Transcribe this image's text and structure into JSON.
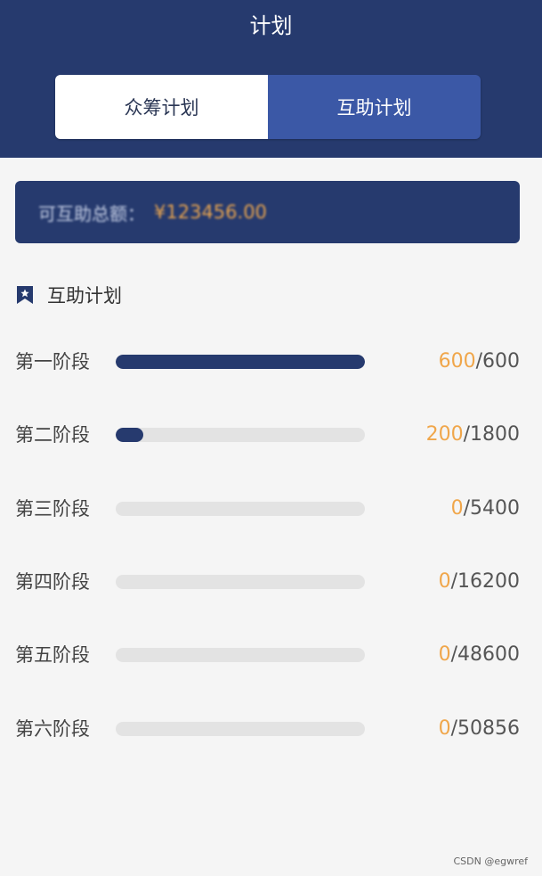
{
  "header": {
    "title": "计划",
    "tabs": [
      {
        "label": "众筹计划",
        "active": false
      },
      {
        "label": "互助计划",
        "active": true
      }
    ]
  },
  "amount_card": {
    "label": "可互助总额：",
    "value": "¥123456.00"
  },
  "section": {
    "icon": "bookmark-icon",
    "title": "互助计划"
  },
  "stages": [
    {
      "label": "第一阶段",
      "current": "600",
      "total": "600",
      "progress": 1.0
    },
    {
      "label": "第二阶段",
      "current": "200",
      "total": "1800",
      "progress": 0.111
    },
    {
      "label": "第三阶段",
      "current": "0",
      "total": "5400",
      "progress": 0
    },
    {
      "label": "第四阶段",
      "current": "0",
      "total": "16200",
      "progress": 0
    },
    {
      "label": "第五阶段",
      "current": "0",
      "total": "48600",
      "progress": 0
    },
    {
      "label": "第六阶段",
      "current": "0",
      "total": "50856",
      "progress": 0
    }
  ],
  "watermark": "CSDN @egwref",
  "colors": {
    "primary": "#263a6e",
    "tab_active": "#3b58a6",
    "accent": "#f0a64a",
    "track": "#e3e3e3"
  }
}
